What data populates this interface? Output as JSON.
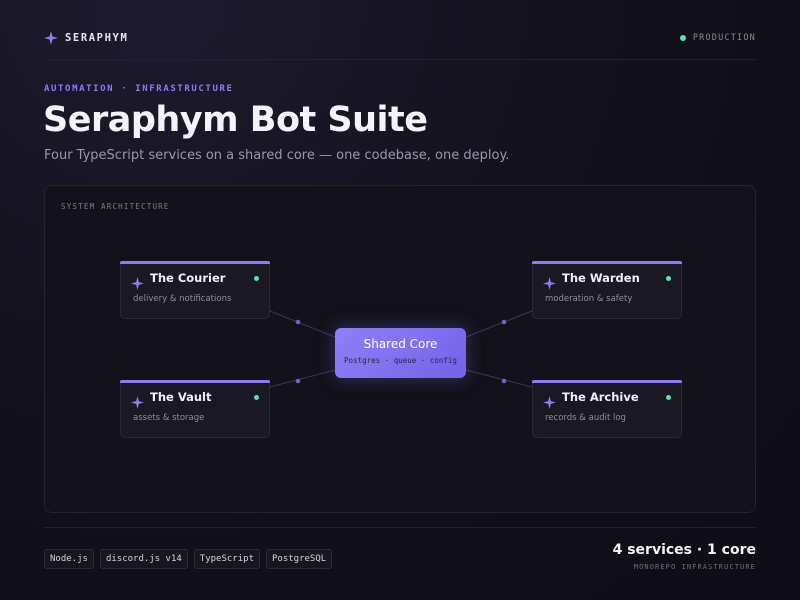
{
  "header": {
    "brand": "SERAPHYM",
    "environment": "PRODUCTION",
    "environment_color": "#5fe0b0"
  },
  "hero": {
    "eyebrow": "AUTOMATION · INFRASTRUCTURE",
    "title": "Seraphym Bot Suite",
    "subtitle": "Four TypeScript services on a shared core — one codebase, one deploy."
  },
  "diagram": {
    "label": "SYSTEM ARCHITECTURE",
    "accent": "#8d7cf6",
    "core": {
      "name": "Shared Core",
      "details": "Postgres · queue · config"
    },
    "services": [
      {
        "name": "The Courier",
        "description": "delivery & notifications",
        "status": "online"
      },
      {
        "name": "The Warden",
        "description": "moderation & safety",
        "status": "online"
      },
      {
        "name": "The Vault",
        "description": "assets & storage",
        "status": "online"
      },
      {
        "name": "The Archive",
        "description": "records & audit log",
        "status": "online"
      }
    ]
  },
  "footer": {
    "tags": [
      "Node.js",
      "discord.js v14",
      "TypeScript",
      "PostgreSQL"
    ],
    "stat": "4 services · 1 core",
    "stat_caption": "MONOREPO INFRASTRUCTURE"
  }
}
